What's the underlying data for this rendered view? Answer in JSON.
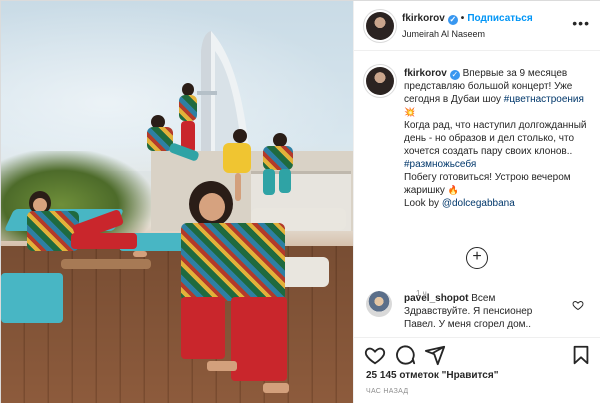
{
  "header": {
    "username": "fkirkorov",
    "follow_label": "Подписаться",
    "location": "Jumeirah Al Naseem",
    "separator": "•",
    "more_label": "•••"
  },
  "caption": {
    "username": "fkirkorov",
    "text_1": "Впервые за 9 месяцев представляю большой концерт! Уже сегодня в Дубаи шоу",
    "hashtag_1": "#цветнастроения",
    "text_2": "Когда рад, что наступил долгожданный день - но образов и дел столько, что хочется создать пару своих клонов..",
    "hashtag_2": "#размножьсебя",
    "text_3": "Побегу готовиться! Устрою вечером жаришку",
    "text_4": "Look by",
    "mention": "@dolcegabbana",
    "time": "1 ч."
  },
  "load_more": "+",
  "comment": {
    "username": "pavel_shopot",
    "text": "Всем Здравствуйте. Я пенсионер Павел. У меня сгорел дом.."
  },
  "actions": {
    "likes": "25 145 отметок \"Нравится\"",
    "timestamp": "ЧАС НАЗАД"
  },
  "icons": {
    "verified": "verified-badge-icon",
    "heart": "heart-icon",
    "comment": "comment-icon",
    "share": "share-icon",
    "save": "bookmark-icon"
  },
  "colors": {
    "link": "#0095f6",
    "hashtag": "#00376b",
    "muted": "#8e8e8e"
  }
}
